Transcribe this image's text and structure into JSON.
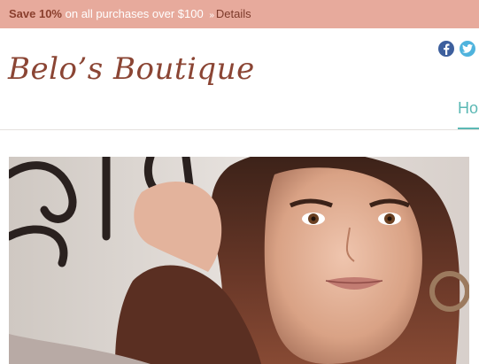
{
  "promo": {
    "strong": "Save 10%",
    "text": "on all purchases over $100",
    "separator": "»",
    "link": "Details"
  },
  "logo": {
    "text": "Belo’s Boutique"
  },
  "social": {
    "facebook_icon": "facebook-icon",
    "twitter_icon": "twitter-icon"
  },
  "nav": {
    "home_label_visible": "Ho"
  },
  "colors": {
    "promo_bg": "#e7aa9c",
    "brand_brown": "#8b4534",
    "accent_teal": "#5bb8b4"
  }
}
